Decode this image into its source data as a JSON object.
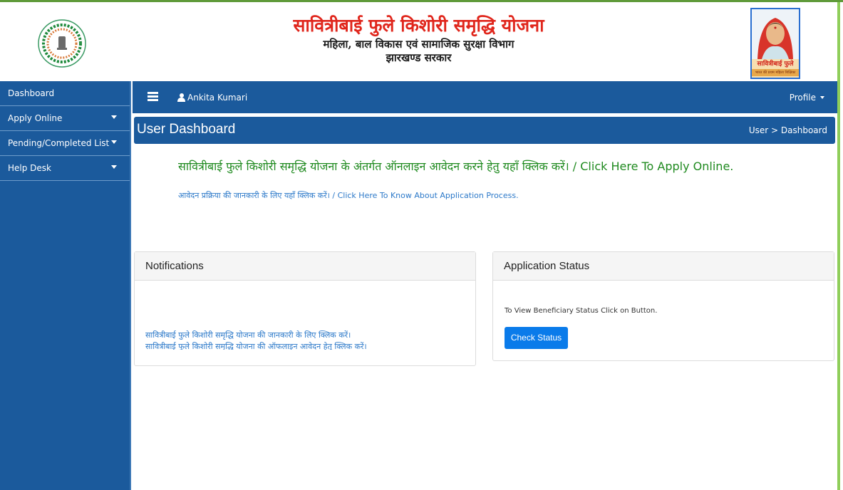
{
  "header": {
    "title": "सावित्रीबाई फुले किशोरी समृद्धि योजना",
    "department": "महिला, बाल विकास एवं सामाजिक सुरक्षा विभाग",
    "government": "झारखण्ड सरकार",
    "logo_icon": "government-of-jharkhand-emblem",
    "portrait_caption": "सावित्रीबाई फुले",
    "portrait_subcaption": "भारत की प्रथम महिला शिक्षिका"
  },
  "sidebar": {
    "items": [
      {
        "label": "Dashboard",
        "has_dropdown": false
      },
      {
        "label": "Apply Online",
        "has_dropdown": true
      },
      {
        "label": "Pending/Completed List",
        "has_dropdown": true
      },
      {
        "label": "Help Desk",
        "has_dropdown": true
      }
    ]
  },
  "topnav": {
    "menu_icon": "hamburger-icon",
    "user_icon": "user-icon",
    "user_name": "Ankita Kumari",
    "profile_label": "Profile"
  },
  "page": {
    "title": "User Dashboard",
    "breadcrumb": "User > Dashboard"
  },
  "main": {
    "apply_link": "सावित्रीबाई फुले किशोरी समृद्धि योजना के अंतर्गत ऑनलाइन आवेदन करने हेतु यहाँ क्लिक करें। / Click Here To Apply Online.",
    "process_link": "आवेदन प्रक्रिया की जानकारी के लिए यहाँ क्लिक करें। / Click Here To Know About Application Process."
  },
  "notifications": {
    "title": "Notifications",
    "items": [
      "सावित्रीबाई फुले किशोरी समृद्धि योजना की जानकारी के लिए क्लिक करें।",
      "सावित्रीबाई फुले किशोरी समृद्धि योजना की ऑफलाइन आवेदन हेतु क्लिक करें।"
    ]
  },
  "application_status": {
    "title": "Application Status",
    "description": "To View Beneficiary Status Click on Button.",
    "button_label": "Check Status"
  },
  "colors": {
    "primary_blue": "#1b5a9c",
    "title_red": "#e0261c",
    "link_green": "#1f8a1f",
    "link_blue": "#2c79c9",
    "button_blue": "#0a7bea",
    "accent_green": "#8fce5a"
  }
}
